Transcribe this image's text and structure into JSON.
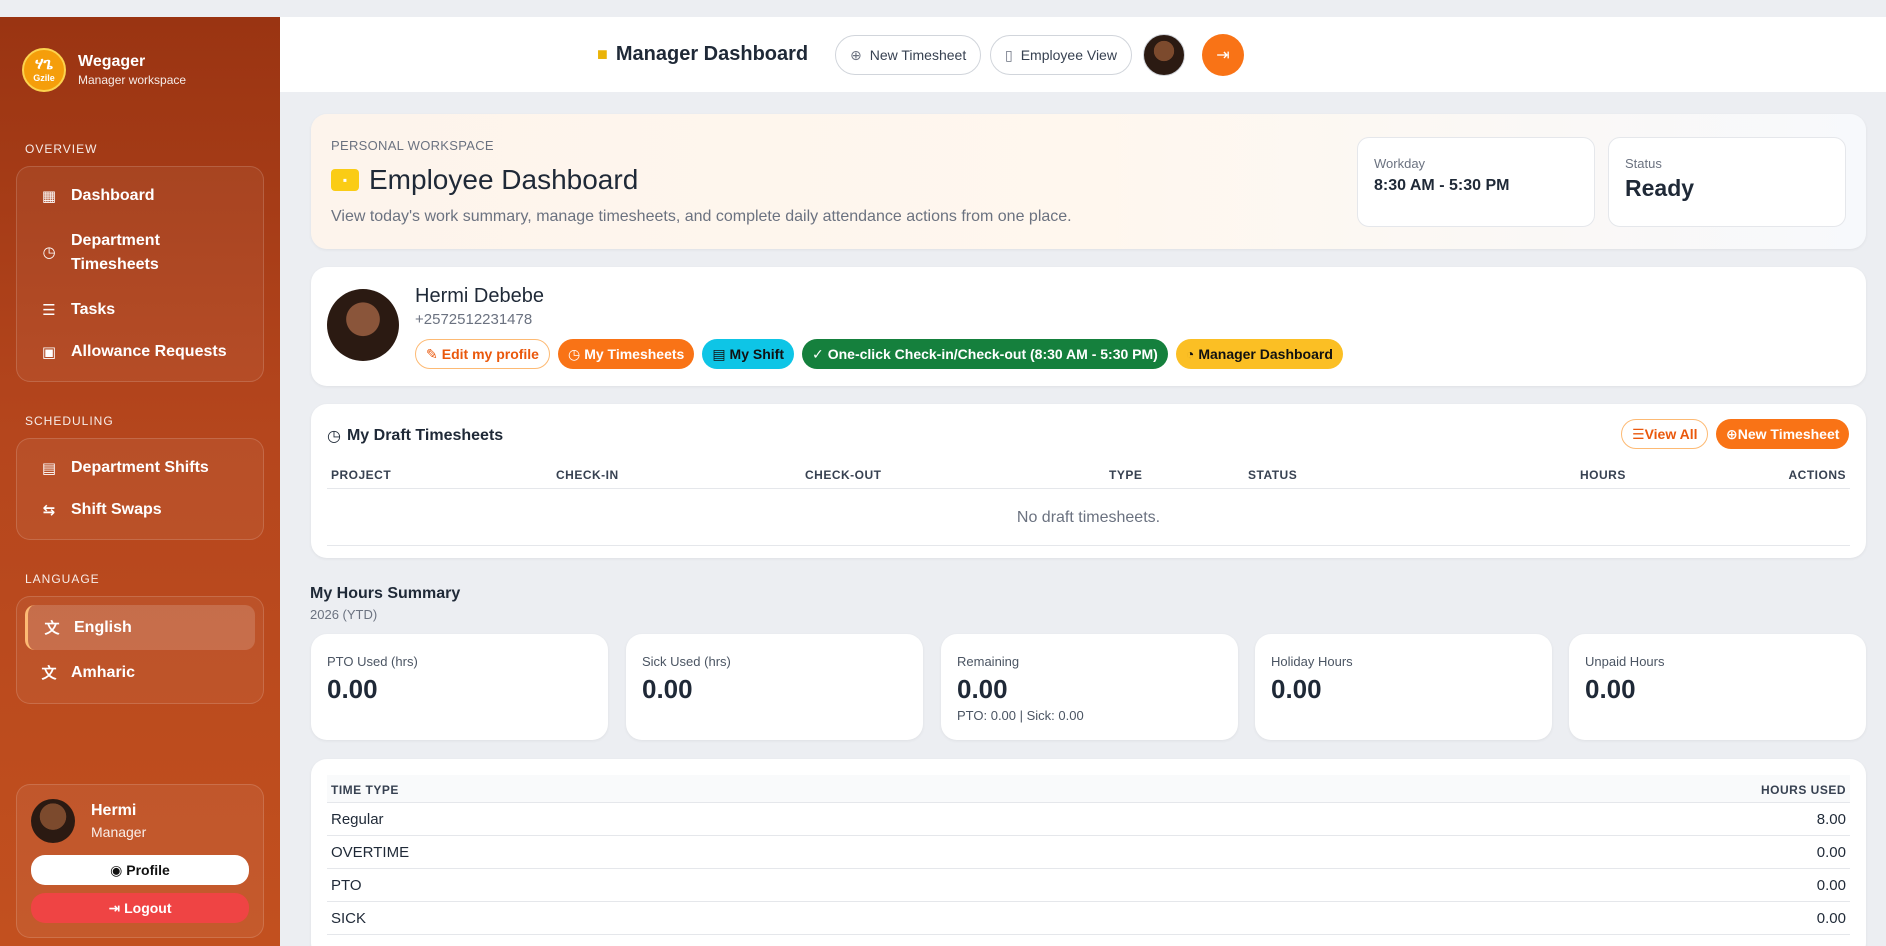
{
  "brand": {
    "logo_top": "ሃጌ",
    "logo_bottom": "Gzile",
    "title": "Wegager",
    "subtitle": "Manager workspace"
  },
  "sidebar": {
    "sections": [
      {
        "label": "OVERVIEW",
        "items": [
          {
            "label": "Dashboard",
            "icon": "grid-icon"
          },
          {
            "label_line1": "Department",
            "label_line2": "Timesheets",
            "icon": "clock-icon"
          },
          {
            "label": "Tasks",
            "icon": "list-icon"
          },
          {
            "label": "Allowance Requests",
            "icon": "inbox-icon"
          }
        ]
      },
      {
        "label": "SCHEDULING",
        "items": [
          {
            "label": "Department Shifts",
            "icon": "calendar-icon"
          },
          {
            "label": "Shift Swaps",
            "icon": "swap-icon"
          }
        ]
      },
      {
        "label": "LANGUAGE",
        "items": [
          {
            "label": "English",
            "icon": "translate-icon",
            "active": true
          },
          {
            "label": "Amharic",
            "icon": "translate-icon"
          }
        ]
      }
    ],
    "user": {
      "name": "Hermi",
      "role": "Manager",
      "profile_label": "Profile",
      "logout_label": "Logout"
    }
  },
  "topbar": {
    "title": "Manager Dashboard",
    "new_timesheet": "New Timesheet",
    "employee_view": "Employee View"
  },
  "hero": {
    "kicker": "PERSONAL WORKSPACE",
    "title": "Employee Dashboard",
    "description": "View today's work summary, manage timesheets, and complete daily attendance actions from one place.",
    "workday_label": "Workday",
    "workday_value": "8:30 AM - 5:30 PM",
    "status_label": "Status",
    "status_value": "Ready"
  },
  "profile": {
    "name": "Hermi Debebe",
    "phone": "+2572512231478",
    "badges": {
      "edit": "Edit my profile",
      "timesheets": "My Timesheets",
      "shift": "My Shift",
      "check": "One-click Check-in/Check-out (8:30 AM - 5:30 PM)",
      "manager": "Manager Dashboard"
    }
  },
  "drafts": {
    "title": "My Draft Timesheets",
    "view_all": "View All",
    "new_timesheet": "New Timesheet",
    "columns": [
      "PROJECT",
      "CHECK-IN",
      "CHECK-OUT",
      "TYPE",
      "STATUS",
      "HOURS",
      "ACTIONS"
    ],
    "empty": "No draft timesheets."
  },
  "summary": {
    "title": "My Hours Summary",
    "subtitle": "2026 (YTD)",
    "cards": [
      {
        "label": "PTO Used (hrs)",
        "value": "0.00"
      },
      {
        "label": "Sick Used (hrs)",
        "value": "0.00"
      },
      {
        "label": "Remaining",
        "value": "0.00",
        "sub": "PTO: 0.00 | Sick: 0.00"
      },
      {
        "label": "Holiday Hours",
        "value": "0.00"
      },
      {
        "label": "Unpaid Hours",
        "value": "0.00"
      }
    ]
  },
  "time_types": {
    "columns": [
      "TIME TYPE",
      "HOURS USED"
    ],
    "rows": [
      {
        "type": "Regular",
        "hours": "8.00"
      },
      {
        "type": "OVERTIME",
        "hours": "0.00"
      },
      {
        "type": "PTO",
        "hours": "0.00"
      },
      {
        "type": "SICK",
        "hours": "0.00"
      }
    ]
  }
}
